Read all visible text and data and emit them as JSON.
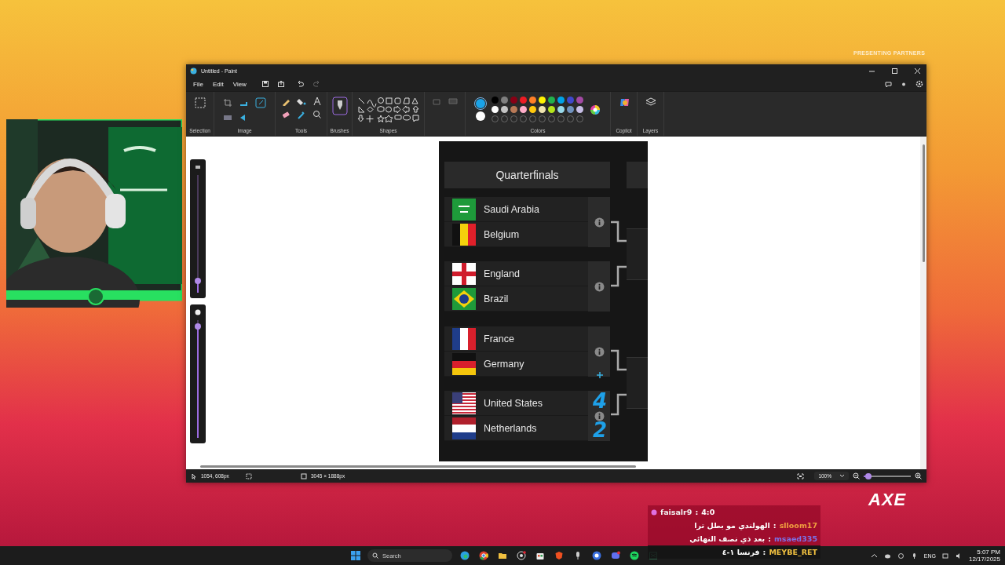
{
  "overlay": {
    "partners_label": "PRESENTING PARTNERS",
    "sponsor_logo": "AXE"
  },
  "side_sliders": [
    {
      "level": 0.1
    },
    {
      "level": 0.95
    }
  ],
  "window": {
    "title": "Untitled - Paint",
    "menu": [
      "File",
      "Edit",
      "View"
    ],
    "ribbon_groups": [
      "Selection",
      "Image",
      "Tools",
      "Brushes",
      "Shapes",
      "Colors",
      "Copilot",
      "Layers"
    ],
    "primary": {
      "color": "#1aa3e8"
    },
    "secondary": {
      "color": "#ffffff"
    },
    "palette": [
      {
        "color": "#000000"
      },
      {
        "color": "#7f7f7f"
      },
      {
        "color": "#880015"
      },
      {
        "color": "#ed1c24"
      },
      {
        "color": "#ff7f27"
      },
      {
        "color": "#fff200"
      },
      {
        "color": "#22b14c"
      },
      {
        "color": "#00a2e8"
      },
      {
        "color": "#3f48cc"
      },
      {
        "color": "#a349a4"
      },
      {
        "color": "#ffffff"
      },
      {
        "color": "#c3c3c3"
      },
      {
        "color": "#b97a57"
      },
      {
        "color": "#ffaec9"
      },
      {
        "color": "#ffc90e"
      },
      {
        "color": "#efe4b0"
      },
      {
        "color": "#b5e61d"
      },
      {
        "color": "#99d9ea"
      },
      {
        "color": "#7092be"
      },
      {
        "color": "#c8bfe7"
      }
    ],
    "canvas": {
      "round_title": "Quarterfinals",
      "matches": [
        {
          "teams": [
            {
              "name": "Saudi Arabia",
              "kind": "sa"
            },
            {
              "name": "Belgium",
              "kind": "be"
            }
          ]
        },
        {
          "teams": [
            {
              "name": "England",
              "kind": "en"
            },
            {
              "name": "Brazil",
              "kind": "br"
            }
          ]
        },
        {
          "teams": [
            {
              "name": "France",
              "kind": "fr"
            },
            {
              "name": "Germany",
              "kind": "de"
            }
          ]
        },
        {
          "teams": [
            {
              "name": "United States",
              "kind": "us"
            },
            {
              "name": "Netherlands",
              "kind": "nl"
            }
          ]
        }
      ],
      "annotations": [
        "4",
        "2"
      ]
    },
    "status_bar": {
      "cursor_position": "1054, 608px",
      "canvas_size": "3045 × 1888px",
      "zoom": "100%",
      "zoom_slider": {
        "level": 0.1
      }
    }
  },
  "chat": [
    {
      "user": "faisalr9",
      "separator": ":",
      "message": "4:0",
      "color": "#f2f2f2",
      "badge": true,
      "rtl": false
    },
    {
      "user": "slloom17",
      "separator": ":",
      "message": "الهولندي مو بطل ترا",
      "color": "#f0a040",
      "badge": false,
      "rtl": true
    },
    {
      "user": "msaed335",
      "separator": ":",
      "message": "بعد ذي نصف النهائي",
      "color": "#7b72e8",
      "badge": false,
      "rtl": true
    },
    {
      "user": "MEYBE_RET",
      "separator": ":",
      "message": "فرنسا ١-٤",
      "color": "#f0c040",
      "badge": false,
      "rtl": true
    }
  ],
  "taskbar": {
    "search_placeholder": "Search",
    "language": "ENG",
    "time": "5:07 PM",
    "date": "12/17/2025"
  }
}
